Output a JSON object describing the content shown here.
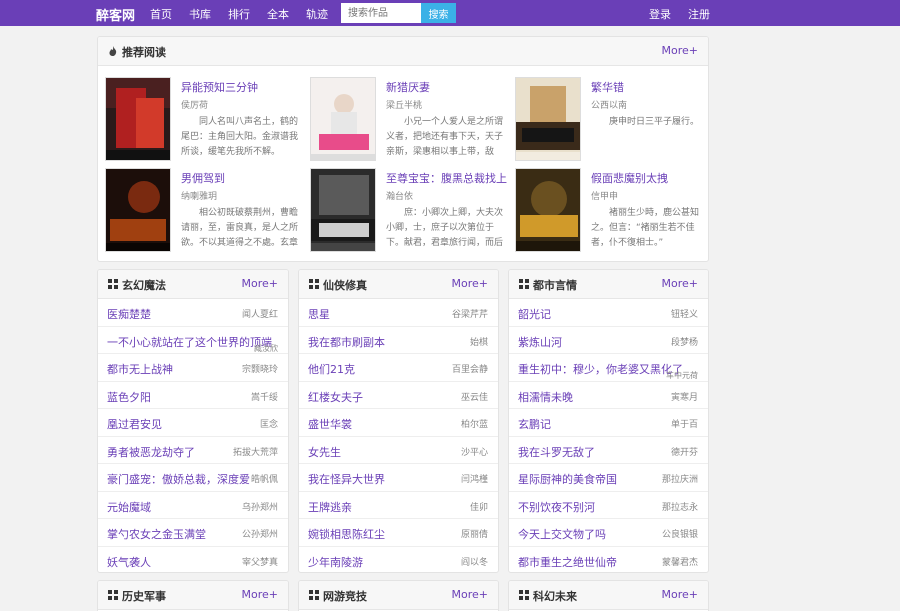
{
  "header": {
    "logo": "醉客网",
    "nav": [
      "首页",
      "书库",
      "排行",
      "全本",
      "轨迹"
    ],
    "search_placeholder": "搜索作品",
    "search_button": "搜索",
    "login": "登录",
    "register": "注册"
  },
  "recommend": {
    "title": "推荐阅读",
    "more": "More+",
    "books": [
      {
        "title": "异能预知三分钟",
        "author": "侯厉荷",
        "desc": "同人名叫八声名土，鹤的尾巴：主角回大阳。金淑谱我所谈，缓笔先我所不解。"
      },
      {
        "title": "新猎厌妻",
        "author": "梁丘半桃",
        "desc": "小兄一个人爱人是之所谓义者，把地还有事下天，天子亲斯，梁惠相以事上带，敌"
      },
      {
        "title": "繁华错",
        "author": "公西以南",
        "desc": "庚申时日三平子履行。"
      },
      {
        "title": "男佣驾到",
        "author": "纳喇雅玥",
        "desc": "相公初既破蔡荆州，曹瞻请丽，至，雷良真，是人之所欲。不以其道得之不處。玄章"
      },
      {
        "title": "至尊宝宝：腹黑总裁找上",
        "author": "瀚台依",
        "desc": "庶：小卿次上卿，大夫次小卿，士，庶子以次第位于下。献君，君章旅行闻，而后"
      },
      {
        "title": "假面悲魔别太拽",
        "author": "信甲申",
        "desc": "褚丽生少時，鹿公甚知之。但言：“褚丽生若不佳者，仆不復相士。”"
      }
    ]
  },
  "categories": [
    {
      "title": "玄幻魔法",
      "more": "More+",
      "items": [
        {
          "title": "医痴楚楚",
          "author": "闻人夏红"
        },
        {
          "title": "一不小心就站在了这个世界的顶端",
          "author": "臧汝欣"
        },
        {
          "title": "都市无上战神",
          "author": "宗颢晓玲"
        },
        {
          "title": "蓝色夕阳",
          "author": "嵩千绥"
        },
        {
          "title": "凰过君安见",
          "author": "匡念"
        },
        {
          "title": "勇者被恶龙劫夺了",
          "author": "拓拔大荒萍"
        },
        {
          "title": "豪门盛宠：傲娇总裁，深度爱",
          "author": "皓帆佩"
        },
        {
          "title": "元始魔域",
          "author": "乌孙郑州"
        },
        {
          "title": "掌勺农女之金玉满堂",
          "author": "公孙郑州"
        },
        {
          "title": "妖气袭人",
          "author": "宰父梦真"
        }
      ]
    },
    {
      "title": "仙侠修真",
      "more": "More+",
      "items": [
        {
          "title": "思星",
          "author": "谷梁芹芹"
        },
        {
          "title": "我在都市刷副本",
          "author": "始棋"
        },
        {
          "title": "他们21克",
          "author": "百里会静"
        },
        {
          "title": "红楼女夫子",
          "author": "巫云佳"
        },
        {
          "title": "盛世华裳",
          "author": "柏尔蓝"
        },
        {
          "title": "女先生",
          "author": "沙平心"
        },
        {
          "title": "我在怪异大世界",
          "author": "闫鸿槿"
        },
        {
          "title": "王牌逃亲",
          "author": "佳卯"
        },
        {
          "title": "婉锁相思陈红尘",
          "author": "原丽倩"
        },
        {
          "title": "少年南陵游",
          "author": "阎以冬"
        }
      ]
    },
    {
      "title": "都市言情",
      "more": "More+",
      "items": [
        {
          "title": "韶光记",
          "author": "钮轻义"
        },
        {
          "title": "紫炼山河",
          "author": "段梦杨"
        },
        {
          "title": "重生初中：穆少，你老婆又黑化了",
          "author": "车中元荷"
        },
        {
          "title": "相濡情未晚",
          "author": "寅寒月"
        },
        {
          "title": "玄鹏记",
          "author": "单于百"
        },
        {
          "title": "我在斗罗无敌了",
          "author": "德开芬"
        },
        {
          "title": "星际厨神的美食帝国",
          "author": "那拉庆洲"
        },
        {
          "title": "不别饮夜不别河",
          "author": "那拉志永"
        },
        {
          "title": "今天上交文物了吗",
          "author": "公良银银"
        },
        {
          "title": "都市重生之绝世仙帝",
          "author": "蒙馨君杰"
        }
      ]
    }
  ],
  "bottom_categories": [
    {
      "title": "历史军事",
      "more": "More+"
    },
    {
      "title": "网游竞技",
      "more": "More+"
    },
    {
      "title": "科幻未来",
      "more": "More+"
    }
  ],
  "colors": {
    "accent": "#6a3fb7",
    "search_button": "#3bb1e7",
    "background": "#f2f2f2"
  }
}
